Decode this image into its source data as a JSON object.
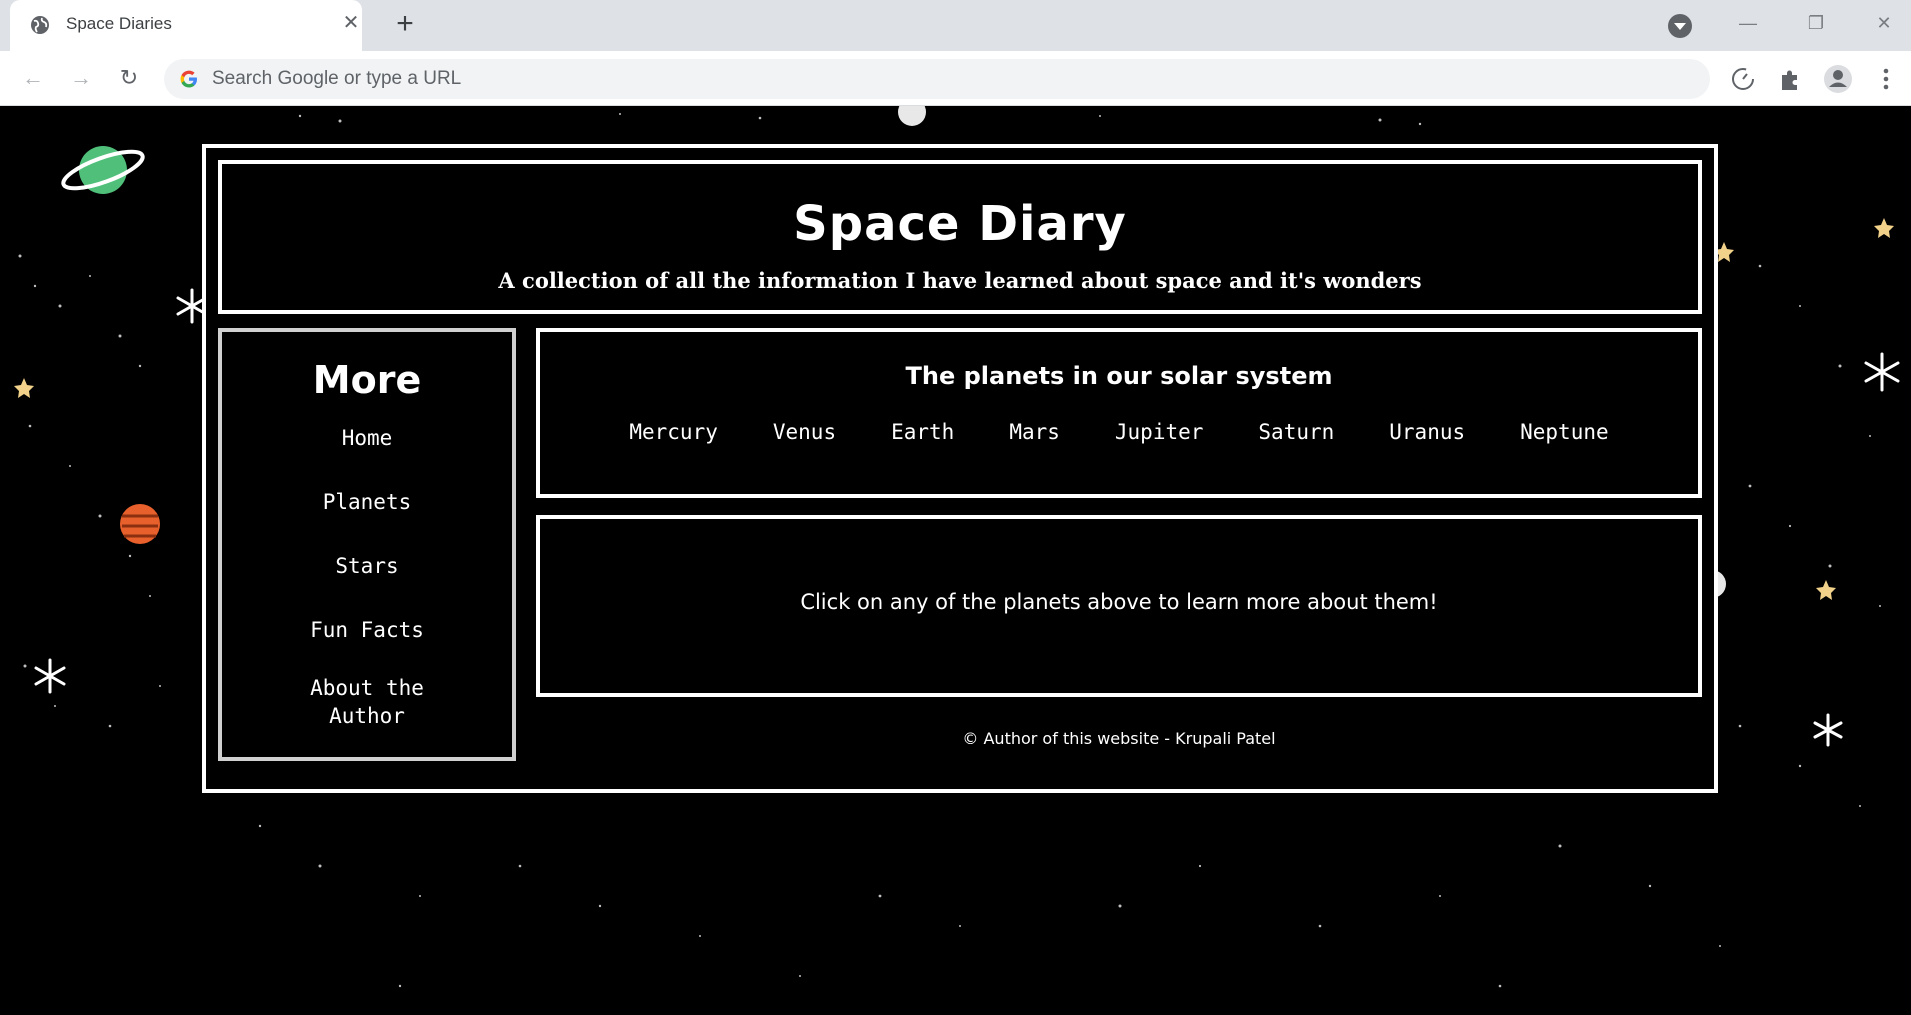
{
  "browser": {
    "tab_title": "Space Diaries",
    "tab_close": "✕",
    "new_tab": "+",
    "omnibox_placeholder": "Search Google or type a URL",
    "minimize": "—",
    "restore": "❐",
    "close": "✕"
  },
  "header": {
    "title": "Space Diary",
    "subtitle": "A collection of all the information I have learned about space and it's wonders"
  },
  "sidebar": {
    "title": "More",
    "links": [
      {
        "label": "Home"
      },
      {
        "label": "Planets"
      },
      {
        "label": "Stars"
      },
      {
        "label": "Fun Facts"
      },
      {
        "label": "About the"
      },
      {
        "label": "Author"
      }
    ]
  },
  "planets": {
    "title": "The planets in our solar system",
    "items": [
      "Mercury",
      "Venus",
      "Earth",
      "Mars",
      "Jupiter",
      "Saturn",
      "Uranus",
      "Neptune"
    ]
  },
  "info": {
    "text": "Click on any of the planets above to learn more about them!"
  },
  "footer": {
    "text": "© Author of this website - Krupali Patel"
  },
  "colors": {
    "chrome_tab_bar": "#dee1e6",
    "page_background": "#000000",
    "border": "#ffffff",
    "sidebar_border": "#d0d0d0"
  }
}
